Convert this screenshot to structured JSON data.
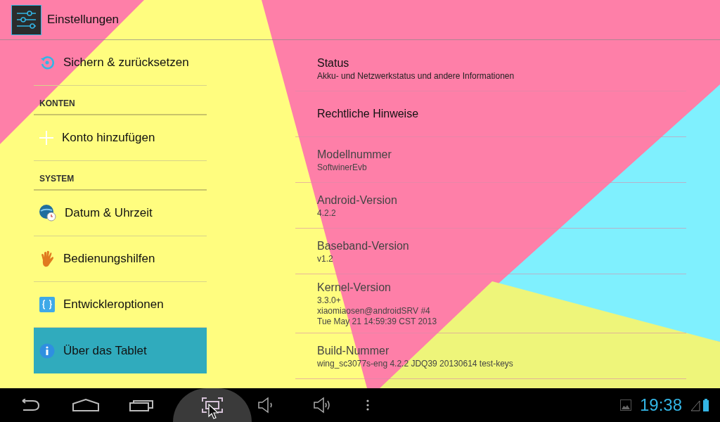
{
  "action_bar": {
    "title": "Einstellungen"
  },
  "sidebar": {
    "items": [
      {
        "kind": "item",
        "label": "Sichern & zurücksetzen",
        "selected": false
      },
      {
        "kind": "header",
        "label": "KONTEN"
      },
      {
        "kind": "item",
        "label": "Konto hinzufügen",
        "selected": false
      },
      {
        "kind": "header",
        "label": "SYSTEM"
      },
      {
        "kind": "item",
        "label": "Datum & Uhrzeit",
        "selected": false
      },
      {
        "kind": "item",
        "label": "Bedienungshilfen",
        "selected": false
      },
      {
        "kind": "item",
        "label": "Entwickleroptionen",
        "selected": false
      },
      {
        "kind": "item",
        "label": "Über das Tablet",
        "selected": true
      }
    ]
  },
  "details": [
    {
      "title": "Status",
      "summary": [
        "Akku- und Netzwerkstatus und andere Informationen"
      ],
      "disabled": false
    },
    {
      "title": "Rechtliche Hinweise",
      "disabled": false
    },
    {
      "title": "Modellnummer",
      "summary": [
        "SoftwinerEvb"
      ],
      "disabled": true
    },
    {
      "title": "Android-Version",
      "summary": [
        "4.2.2"
      ],
      "disabled": true
    },
    {
      "title": "Baseband-Version",
      "summary": [
        "v1.2"
      ],
      "disabled": true
    },
    {
      "title": "Kernel-Version",
      "summary": [
        "3.3.0+",
        "xiaomiaosen@androidSRV #4",
        "Tue May 21 14:59:39 CST 2013"
      ],
      "disabled": true
    },
    {
      "title": "Build-Nummer",
      "summary": [
        "wing_sc3077s-eng 4.2.2 JDQ39 20130614 test-keys"
      ],
      "disabled": true
    }
  ],
  "status_bar": {
    "time": "19:38"
  }
}
